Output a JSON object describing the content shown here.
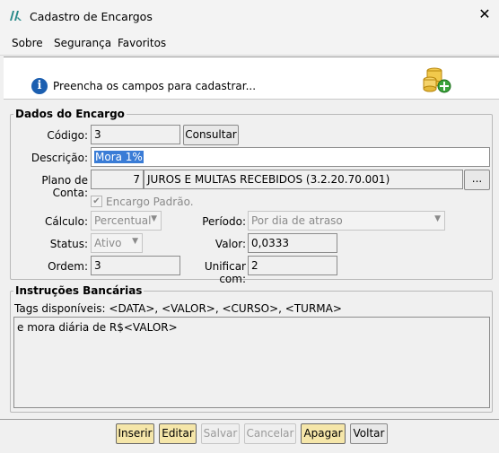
{
  "window": {
    "title": "Cadastro de Encargos",
    "close_glyph": "✕"
  },
  "menu": {
    "items": [
      "Sobre",
      "Segurança",
      "Favoritos"
    ]
  },
  "header": {
    "message": "Preencha os campos para cadastrar...",
    "info_glyph": "i",
    "icon": "coins-add-icon"
  },
  "encargo": {
    "group_label": "Dados do Encargo",
    "codigo_label": "Código:",
    "codigo_value": "3",
    "consultar_label": "Consultar",
    "descricao_label": "Descrição:",
    "descricao_value": "Mora 1%",
    "plano_label": "Plano de Conta:",
    "plano_num": "7",
    "plano_desc": "JUROS E MULTAS RECEBIDOS (3.2.20.70.001)",
    "plano_browse": "...",
    "padrao_label": "Encargo Padrão.",
    "padrao_checked": true,
    "calculo_label": "Cálculo:",
    "calculo_value": "Percentual",
    "periodo_label": "Período:",
    "periodo_value": "Por dia de atraso",
    "status_label": "Status:",
    "status_value": "Ativo",
    "valor_label": "Valor:",
    "valor_value": "0,0333",
    "ordem_label": "Ordem:",
    "ordem_value": "3",
    "unificar_label": "Unificar com:",
    "unificar_value": "2"
  },
  "instrucoes": {
    "group_label": "Instruções Bancárias",
    "tags": "Tags disponíveis: <DATA>, <VALOR>, <CURSO>, <TURMA>",
    "text": "e mora diária de R$<VALOR>"
  },
  "buttons": {
    "inserir": "Inserir",
    "editar": "Editar",
    "salvar": "Salvar",
    "cancelar": "Cancelar",
    "apagar": "Apagar",
    "voltar": "Voltar"
  },
  "colors": {
    "accent_yellow": "#f5e6a9",
    "info_blue": "#1c5fb0",
    "selection": "#3a7cd6"
  }
}
